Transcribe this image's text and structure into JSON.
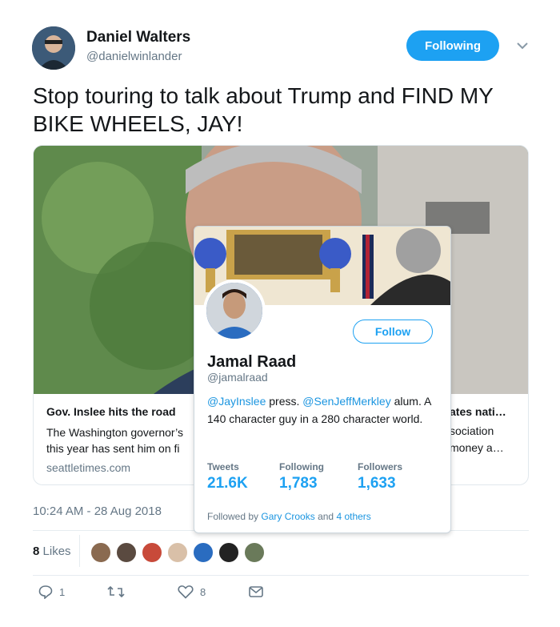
{
  "tweet": {
    "author_name": "Daniel Walters",
    "author_handle": "@danielwinlander",
    "following_label": "Following",
    "text": "Stop touring to talk about Trump and FIND MY BIKE WHEELS, JAY!",
    "timestamp": "10:24 AM - 28 Aug 2018",
    "likes_number": "8",
    "likes_word": "Likes"
  },
  "card": {
    "title": "Gov. Inslee hits the road",
    "description_line1": "The Washington governor’s",
    "description_line2": "this year has sent him on fi",
    "title_right": "ates nati…",
    "description_right1": "sociation",
    "description_right2": "money a…",
    "domain": "seattletimes.com"
  },
  "actions": {
    "reply_count": "1",
    "retweet_count": "",
    "like_count": "8"
  },
  "hovercard": {
    "follow_label": "Follow",
    "name": "Jamal Raad",
    "handle": "@jamalraad",
    "bio_mention1": "@JayInslee",
    "bio_text1": " press. ",
    "bio_mention2": "@SenJeffMerkley",
    "bio_text2": " alum. A 140 character guy in a 280 character world.",
    "stats": [
      {
        "label": "Tweets",
        "value": "21.6K"
      },
      {
        "label": "Following",
        "value": "1,783"
      },
      {
        "label": "Followers",
        "value": "1,633"
      }
    ],
    "followed_by_prefix": "Followed by ",
    "followed_by_name": "Gary Crooks",
    "followed_by_mid": " and ",
    "followed_by_others": "4 others"
  },
  "colors": {
    "accent": "#1da1f2",
    "muted": "#657786",
    "text": "#14171a"
  }
}
